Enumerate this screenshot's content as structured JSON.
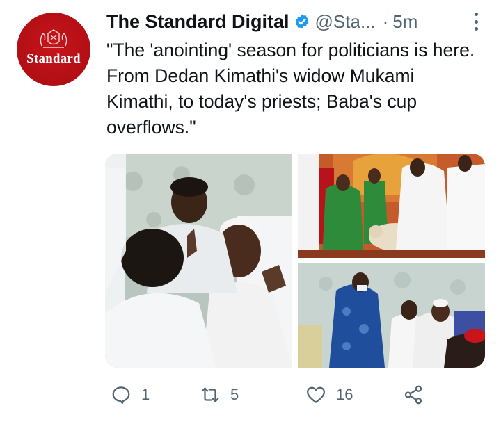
{
  "author": {
    "name": "The Standard Digital",
    "handle": "@Sta...",
    "time_separator": "·",
    "time": "5m",
    "avatar_text": "Standard",
    "brand_color": "#c8141a",
    "verified_color": "#1d9bf0"
  },
  "tweet": {
    "text": "\"The 'anointing' season for politicians is here. From Dedan Kimathi's widow Mukami Kimathi, to today's priests; Baba's cup overflows.\""
  },
  "media": {
    "photos": [
      {
        "description_icon": "photo-1"
      },
      {
        "description_icon": "photo-2"
      },
      {
        "description_icon": "photo-3"
      }
    ]
  },
  "actions": {
    "reply": {
      "icon": "reply-icon",
      "count": "1"
    },
    "retweet": {
      "icon": "retweet-icon",
      "count": "5"
    },
    "like": {
      "icon": "heart-icon",
      "count": "16"
    },
    "share": {
      "icon": "share-icon"
    }
  }
}
